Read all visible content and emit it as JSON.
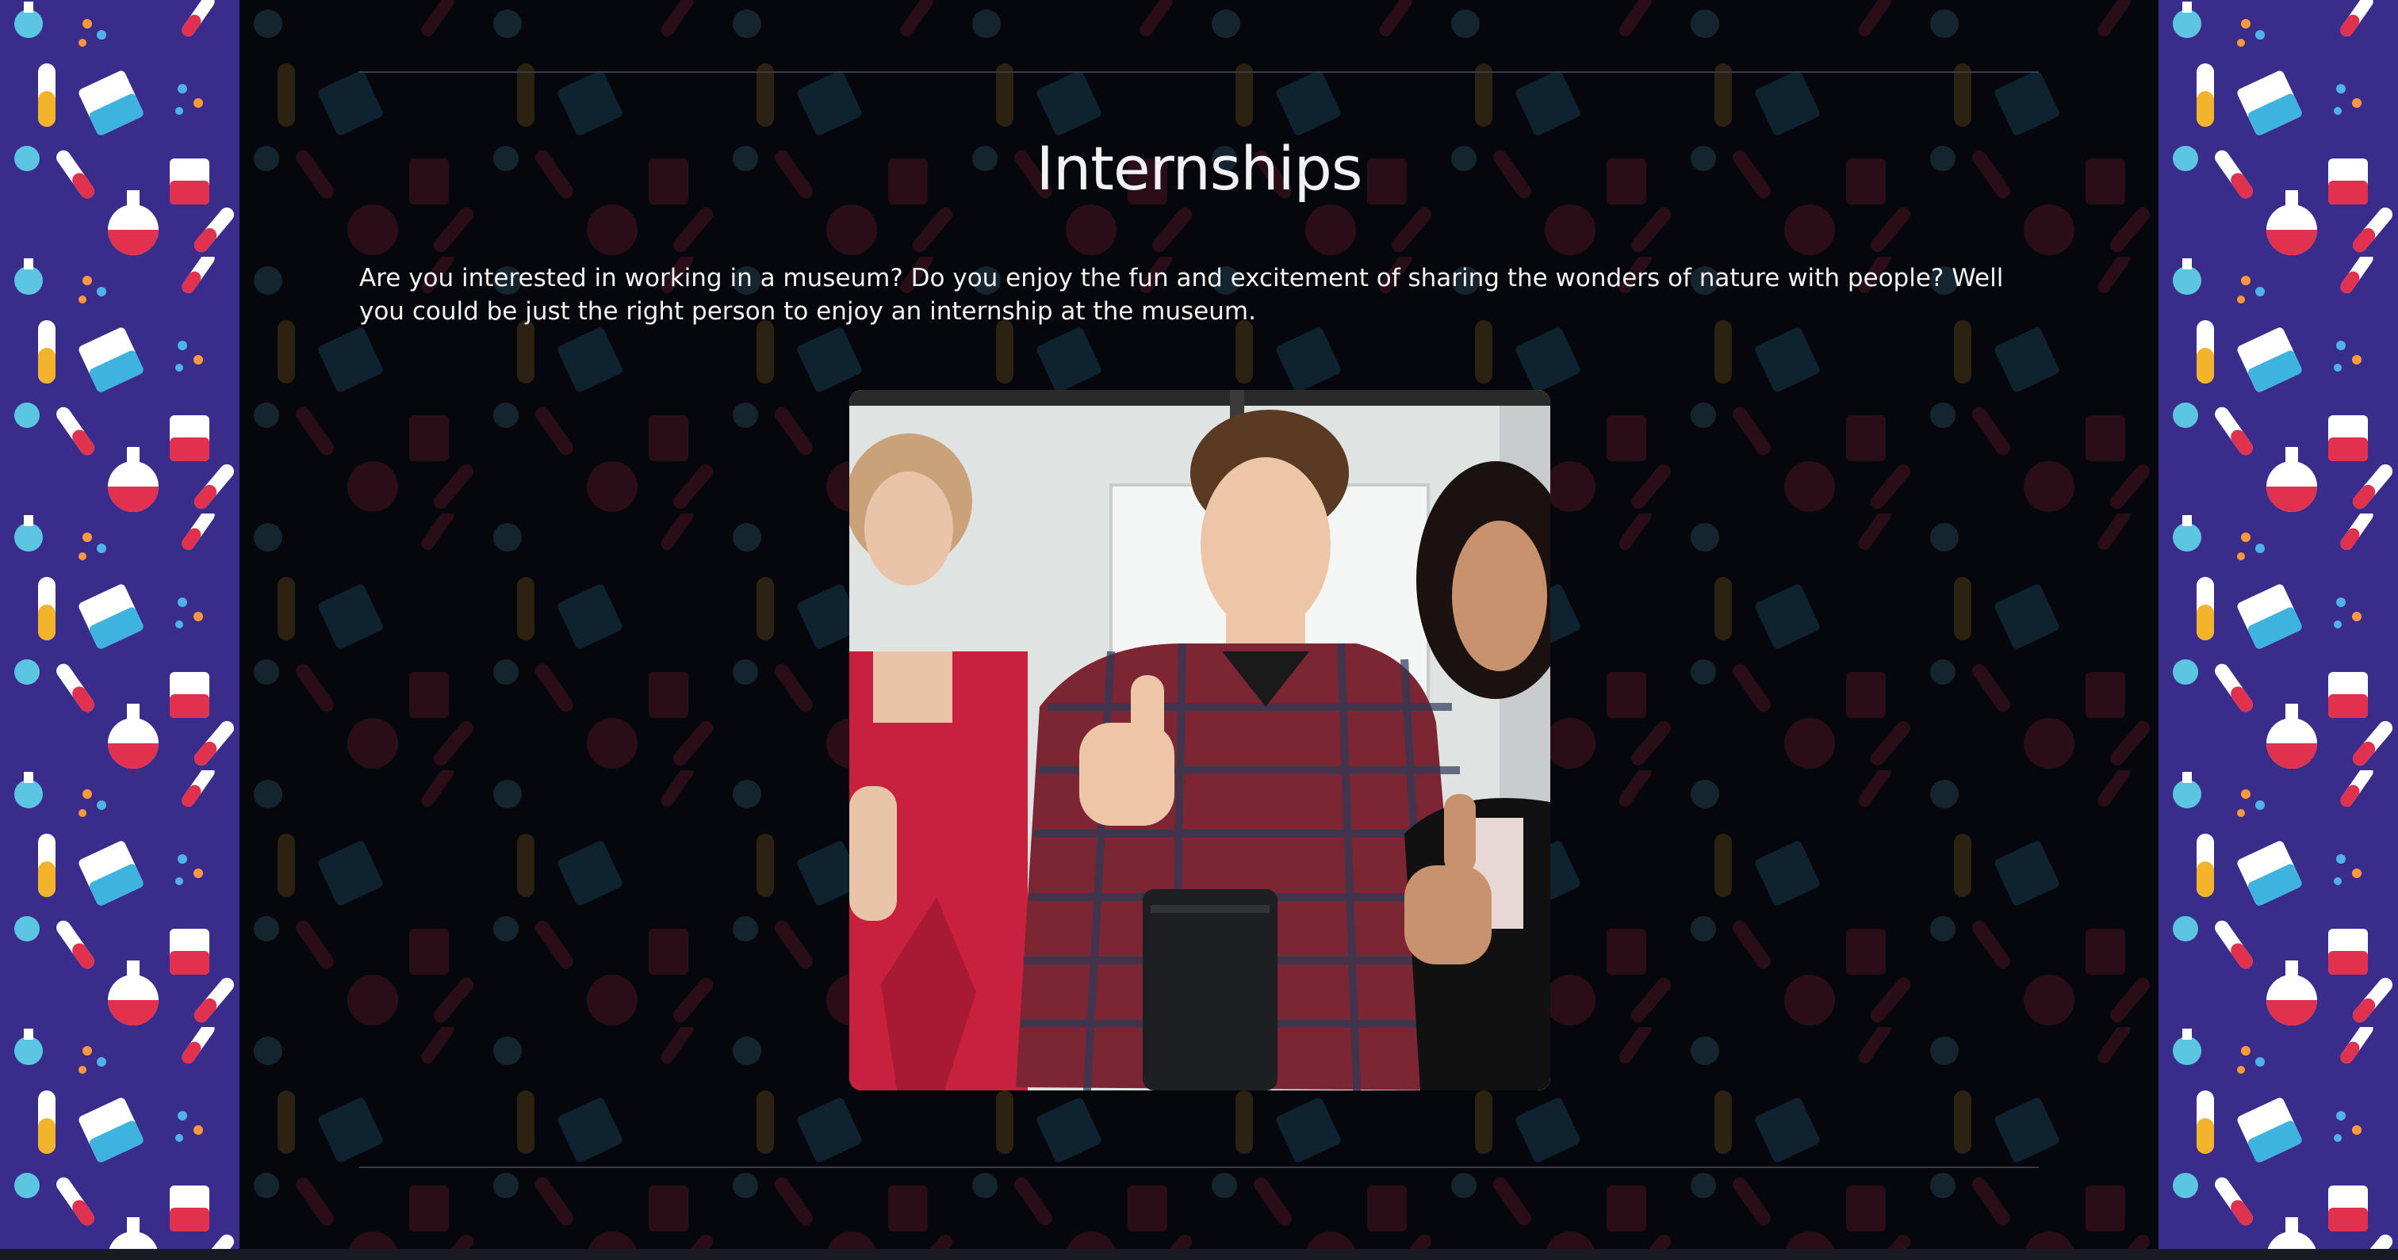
{
  "section": {
    "title": "Internships",
    "intro": "Are you interested in working in a museum? Do you enjoy the fun and excitement of sharing the wonders of nature with people? Well you could be just the right person to enjoy an internship at the museum."
  },
  "image": {
    "description_icon": "interns-thumbs-up-photo"
  },
  "colors": {
    "side_background": "#3a2c8a",
    "main_background": "#06060d",
    "text": "#f2f2f6",
    "divider": "#3a3a48"
  }
}
